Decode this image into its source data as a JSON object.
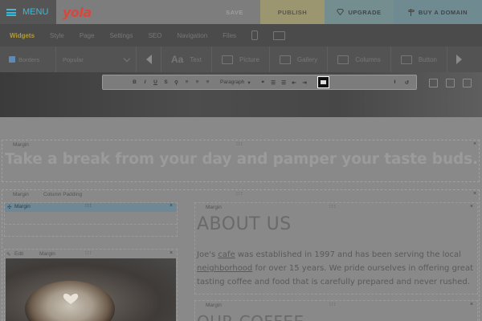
{
  "topbar": {
    "menu_label": "MENU",
    "logo": "yola",
    "save_label": "SAVE",
    "publish_label": "PUBLISH",
    "upgrade_label": "UPGRADE",
    "domain_label": "BUY A DOMAIN"
  },
  "nav": {
    "tabs": [
      {
        "label": "Widgets",
        "active": true
      },
      {
        "label": "Style"
      },
      {
        "label": "Page"
      },
      {
        "label": "Settings"
      },
      {
        "label": "SEO"
      },
      {
        "label": "Navigation"
      },
      {
        "label": "Files"
      }
    ],
    "icons": [
      "mobile-device-icon",
      "desktop-monitor-icon"
    ]
  },
  "widgets": {
    "borders_label": "Borders",
    "category_selected": "Popular",
    "items": [
      {
        "label": "Text",
        "icon": "text-aa-icon"
      },
      {
        "label": "Picture",
        "icon": "picture-icon"
      },
      {
        "label": "Gallery",
        "icon": "gallery-icon"
      },
      {
        "label": "Columns",
        "icon": "columns-icon"
      },
      {
        "label": "Button",
        "icon": "button-icon"
      }
    ]
  },
  "editor": {
    "paragraph_label": "Paragraph",
    "tools": [
      "bold",
      "italic",
      "underline",
      "strikethrough",
      "link",
      "align-left",
      "align-center",
      "align-right",
      "quote",
      "bullet-list",
      "numbered-list",
      "outdent",
      "indent",
      "image",
      "clear-format",
      "undo"
    ]
  },
  "page": {
    "margin_label": "Margin",
    "column_padding_label": "Column Padding",
    "edit_label": "Edit",
    "close_symbol": "×",
    "tagline": "Take a break from your day and pamper your taste buds.",
    "about_heading": "ABOUT US",
    "about_text_1": "Joe's ",
    "about_text_cafe": "cafe",
    "about_text_2": " was established in 1997 and has been serving the local ",
    "about_text_neighborhood": "neighborhood",
    "about_text_3": " for over 15 years.  We pride ourselves in offering great tasting coffee and food that is carefully prepared and never rushed.",
    "coffee_heading": "OUR COFFEE"
  },
  "colors": {
    "accent_blue": "#3fb9d9",
    "logo_red": "#d9463c",
    "publish_yellow": "#9b9570",
    "upgrade_teal": "#748d8f",
    "active_tab": "#b29a38"
  }
}
